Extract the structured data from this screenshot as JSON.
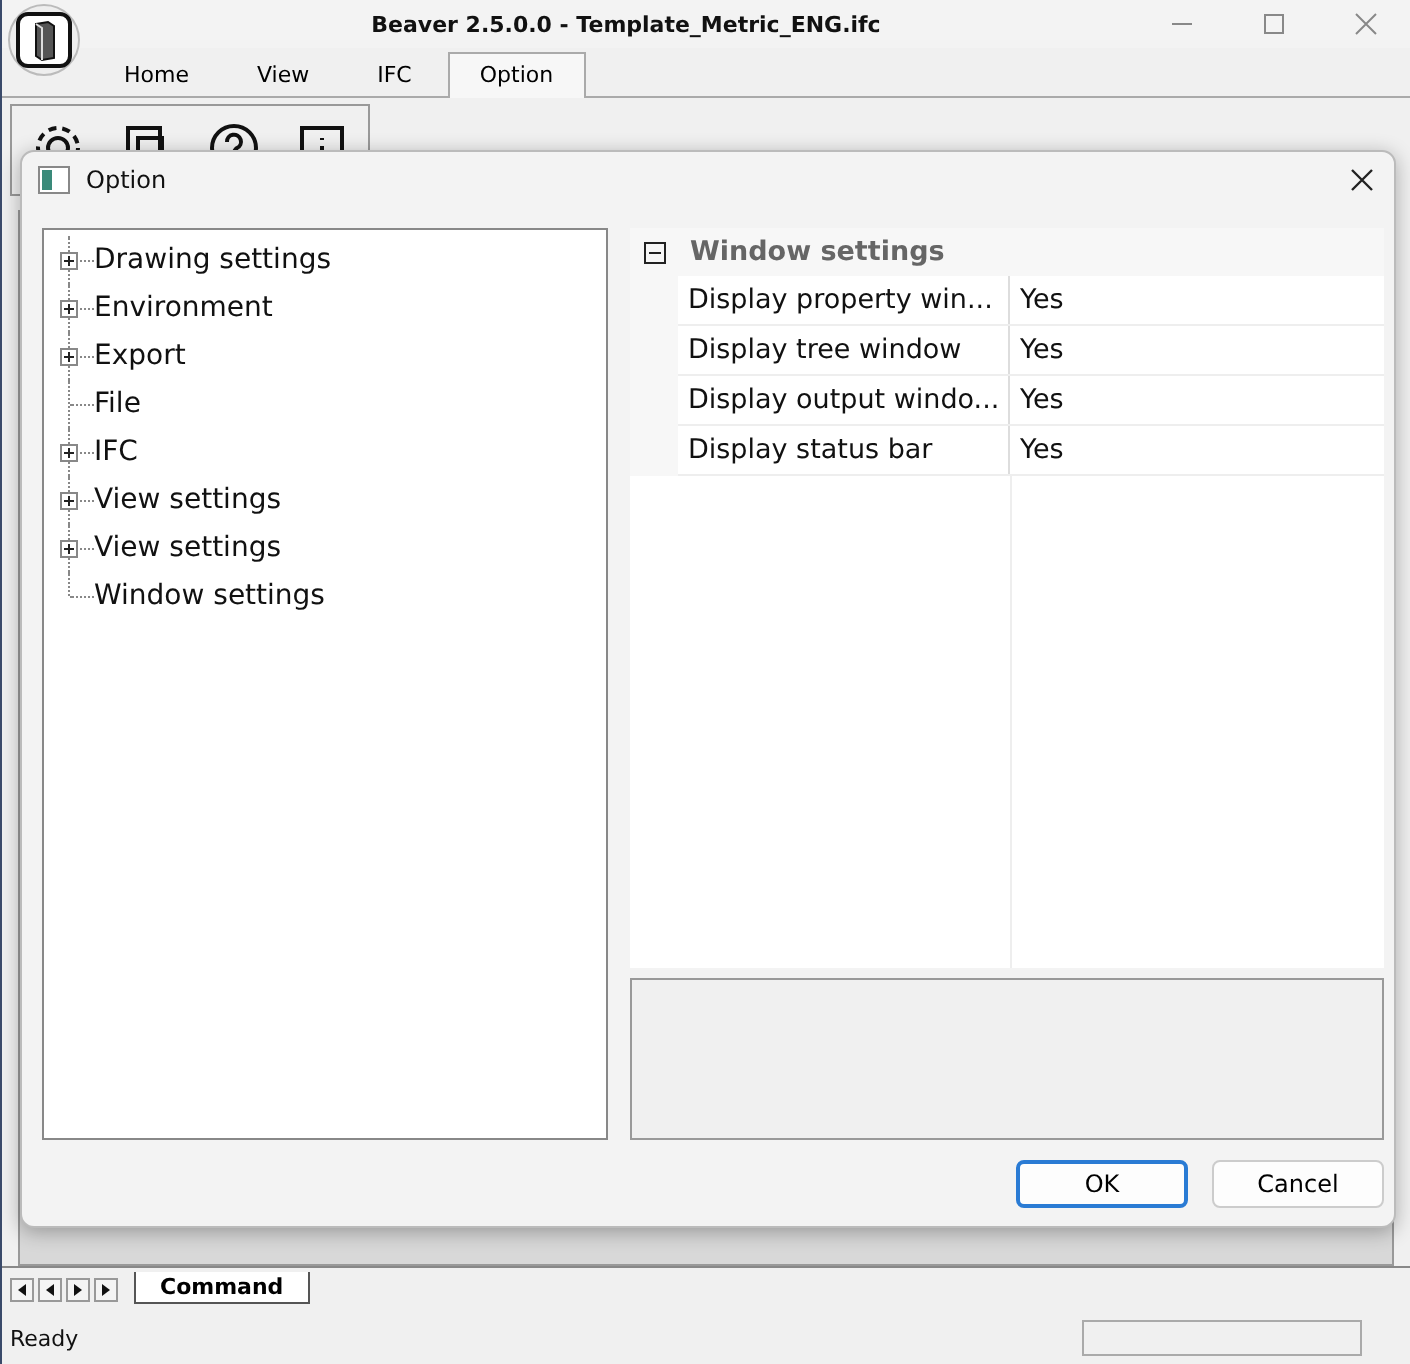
{
  "window": {
    "title": "Beaver 2.5.0.0  - Template_Metric_ENG.ifc"
  },
  "ribbon_tabs": [
    {
      "label": "Home",
      "selected": false
    },
    {
      "label": "View",
      "selected": false
    },
    {
      "label": "IFC",
      "selected": false
    },
    {
      "label": "Option",
      "selected": true
    }
  ],
  "dialog": {
    "title": "Option",
    "tree": [
      {
        "label": "Drawing settings",
        "kind": "group"
      },
      {
        "label": "Environment",
        "kind": "group"
      },
      {
        "label": "Export",
        "kind": "group"
      },
      {
        "label": "File",
        "kind": "leaf"
      },
      {
        "label": "IFC",
        "kind": "group"
      },
      {
        "label": "View settings",
        "kind": "group"
      },
      {
        "label": "View settings",
        "kind": "group"
      },
      {
        "label": "Window settings",
        "kind": "leaf"
      }
    ],
    "category": {
      "label": "Window settings",
      "expanded": true
    },
    "properties": [
      {
        "name": "Display property win...",
        "value": "Yes"
      },
      {
        "name": "Display tree window",
        "value": "Yes"
      },
      {
        "name": "Display output windo...",
        "value": "Yes"
      },
      {
        "name": "Display status bar",
        "value": "Yes"
      }
    ],
    "buttons": [
      {
        "label": "OK",
        "default": true
      },
      {
        "label": "Cancel",
        "default": false
      }
    ]
  },
  "sheet_tabs": [
    {
      "label": "Command",
      "selected": true
    }
  ],
  "status_bar": {
    "text": "Ready"
  }
}
